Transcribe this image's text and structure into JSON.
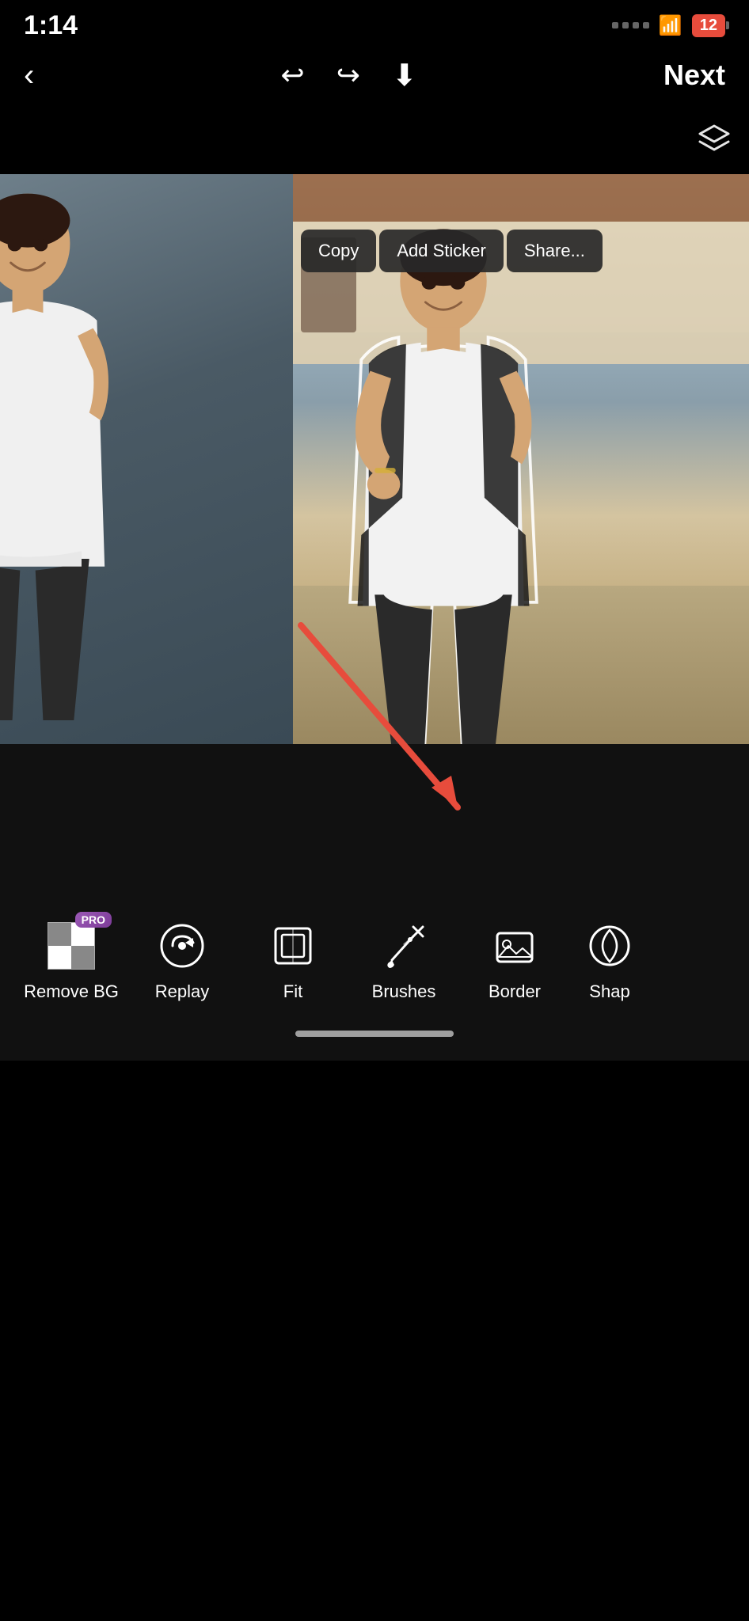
{
  "statusBar": {
    "time": "1:14",
    "battery": "12",
    "batteryColor": "#e74c3c"
  },
  "toolbar": {
    "backLabel": "‹",
    "undoLabel": "↩",
    "redoLabel": "↪",
    "downloadLabel": "⬇",
    "nextLabel": "Next"
  },
  "layersIcon": "layers",
  "contextMenu": {
    "copyLabel": "Copy",
    "addStickerLabel": "Add Sticker",
    "shareLabel": "Share..."
  },
  "bottomTools": [
    {
      "id": "remove-bg",
      "label": "Remove BG",
      "icon": "checkerboard",
      "pro": true
    },
    {
      "id": "replay",
      "label": "Replay",
      "icon": "replay"
    },
    {
      "id": "fit",
      "label": "Fit",
      "icon": "fit"
    },
    {
      "id": "brushes",
      "label": "Brushes",
      "icon": "brush"
    },
    {
      "id": "border",
      "label": "Border",
      "icon": "border",
      "highlighted": true
    },
    {
      "id": "shape",
      "label": "Shap",
      "icon": "shape"
    }
  ],
  "proLabel": "PRO",
  "homeIndicator": true
}
